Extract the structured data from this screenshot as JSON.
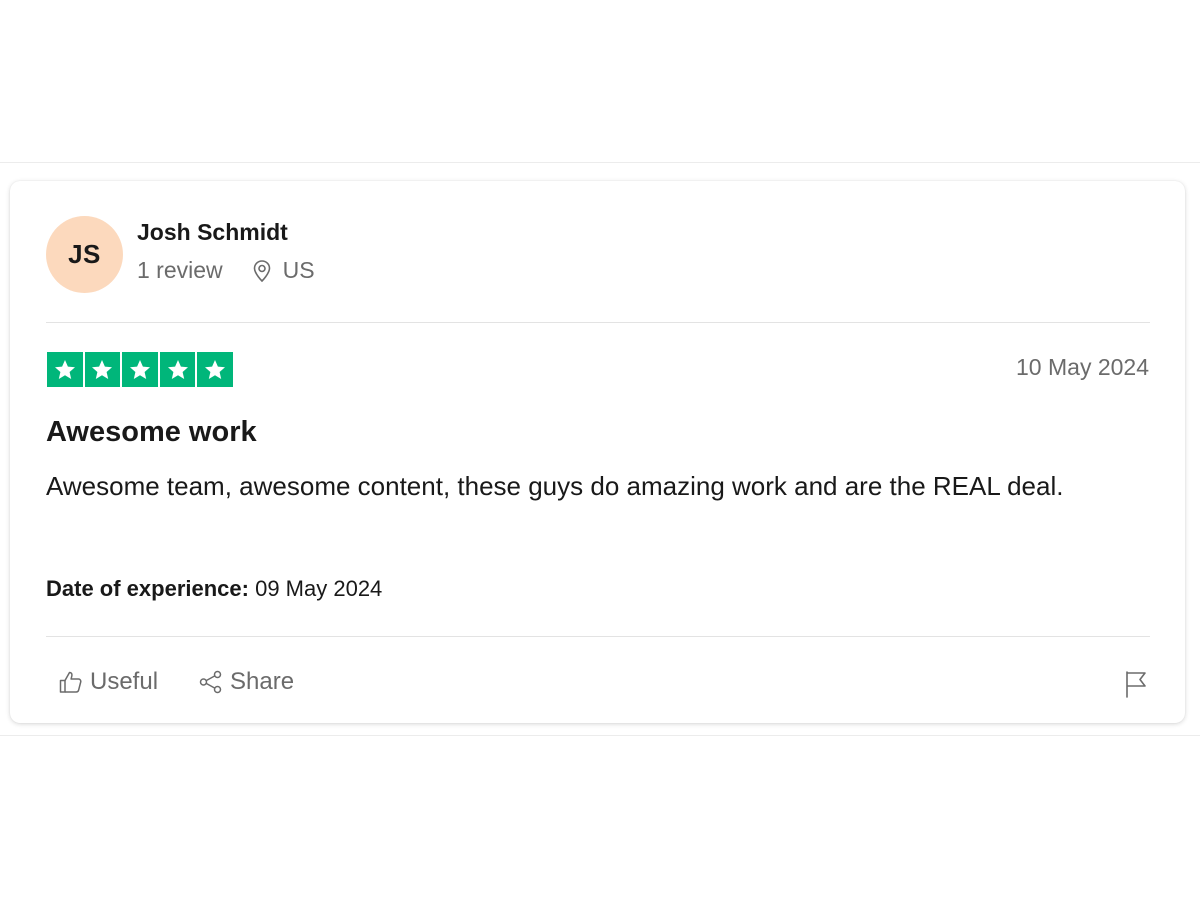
{
  "reviewer": {
    "initials": "JS",
    "name": "Josh Schmidt",
    "review_count": "1 review",
    "country": "US",
    "avatar_color": "#fcd9bd"
  },
  "review": {
    "rating": 5,
    "max_rating": 5,
    "date": "10 May 2024",
    "title": "Awesome work",
    "body": "Awesome team, awesome content, these guys do amazing work and are the REAL deal.",
    "experience_label": "Date of experience:",
    "experience_date": "09 May 2024",
    "star_color": "#00b67a"
  },
  "actions": {
    "useful_label": "Useful",
    "useful_icon": "thumbs-up-icon",
    "share_label": "Share",
    "share_icon": "share-icon",
    "report_icon": "flag-icon"
  }
}
